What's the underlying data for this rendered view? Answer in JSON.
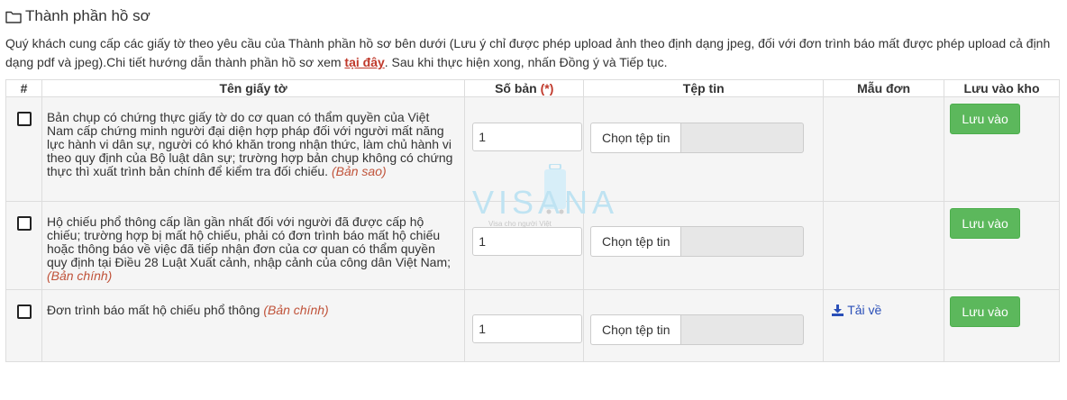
{
  "section": {
    "icon": "folder-icon",
    "title": "Thành phần hồ sơ"
  },
  "intro": {
    "text_before": "Quý khách cung cấp các giấy tờ theo yêu cầu của Thành phần hồ sơ bên dưới (Lưu ý chỉ được phép upload ảnh theo định dạng jpeg, đối với đơn trình báo mất được phép upload cả định dạng pdf và jpeg).Chi tiết hướng dẫn thành phần hồ sơ xem ",
    "link_text": "tại đây",
    "text_after": ". Sau khi thực hiện xong, nhấn Đồng ý và Tiếp tục."
  },
  "table": {
    "headers": {
      "index": "#",
      "name": "Tên giấy tờ",
      "copies": "Số bản",
      "required_mark": "(*)",
      "file": "Tệp tin",
      "form": "Mẫu đơn",
      "save": "Lưu vào kho"
    },
    "rows": [
      {
        "name": "Bản chụp có chứng thực giấy tờ do cơ quan có thẩm quyền của Việt Nam cấp chứng minh người đại diện hợp pháp đối với người mất năng lực hành vi dân sự, người có khó khăn trong nhận thức, làm chủ hành vi theo quy định của Bộ luật dân sự; trường hợp bản chụp không có chứng thực thì xuất trình bản chính để kiểm tra đối chiếu.",
        "kind": "(Bản sao)",
        "copies": "1",
        "file_button": "Chọn tệp tin",
        "form_link": "",
        "save_button": "Lưu vào"
      },
      {
        "name": "Hộ chiếu phổ thông cấp lần gần nhất đối với người đã được cấp hộ chiếu; trường hợp bị mất hộ chiếu, phải có đơn trình báo mất hộ chiếu hoặc thông báo về việc đã tiếp nhận đơn của cơ quan có thẩm quyền quy định tại Điều 28 Luật Xuất cảnh, nhập cảnh của công dân Việt Nam;",
        "kind": "(Bản chính)",
        "copies": "1",
        "file_button": "Chọn tệp tin",
        "form_link": "",
        "save_button": "Lưu vào"
      },
      {
        "name": "Đơn trình báo mất hộ chiếu phổ thông",
        "kind": "(Bản chính)",
        "copies": "1",
        "file_button": "Chọn tệp tin",
        "form_link": "Tải về",
        "save_button": "Lưu vào"
      }
    ]
  },
  "watermark": {
    "brand": "VISANA",
    "tagline": "Visa cho người Việt"
  },
  "colors": {
    "save_button": "#5cb85c",
    "link": "#c0392b",
    "kind_text": "#c0533a",
    "download_link": "#2a4fb8"
  }
}
